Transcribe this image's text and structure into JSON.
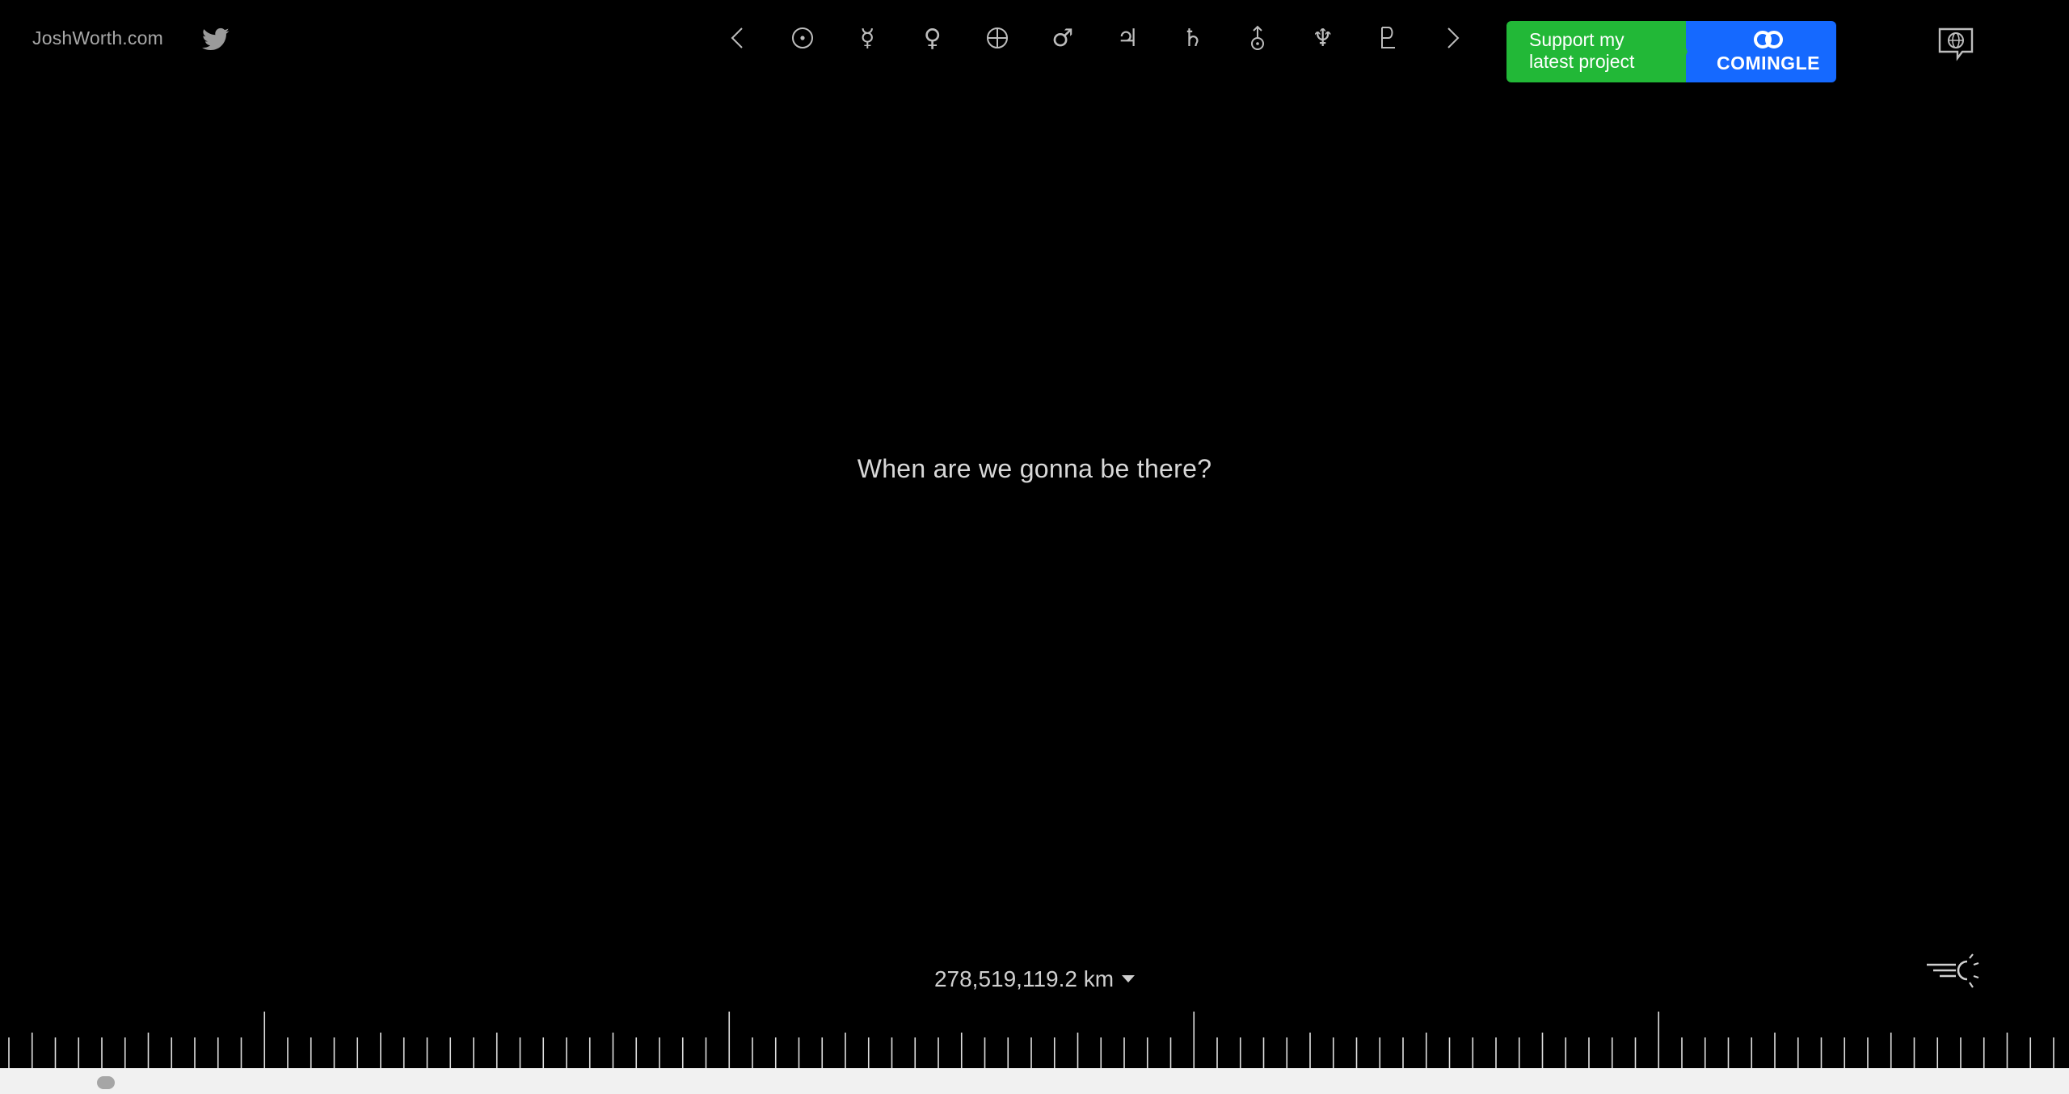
{
  "header": {
    "site_name": "JoshWorth.com",
    "twitter_icon": "twitter-bird-icon"
  },
  "planet_nav": {
    "prev": {
      "icon": "chevron-left-icon"
    },
    "items": [
      {
        "name": "sun",
        "glyph": "☉"
      },
      {
        "name": "mercury",
        "glyph": "☿"
      },
      {
        "name": "venus",
        "glyph": "♀"
      },
      {
        "name": "earth",
        "glyph": "⊕"
      },
      {
        "name": "mars",
        "glyph": "♂"
      },
      {
        "name": "jupiter",
        "glyph": "♃"
      },
      {
        "name": "saturn",
        "glyph": "♄"
      },
      {
        "name": "uranus",
        "glyph": "⛢"
      },
      {
        "name": "neptune",
        "glyph": "♆"
      },
      {
        "name": "pluto",
        "glyph": "♇"
      }
    ],
    "next": {
      "icon": "chevron-right-icon"
    }
  },
  "support": {
    "line1": "Support my",
    "line2": "latest project",
    "brand": "COMINGLE",
    "colors": {
      "left": "#22b837",
      "right": "#1569ff"
    }
  },
  "language_icon": "language-globe-icon",
  "main": {
    "message": "When are we gonna be there?"
  },
  "footer": {
    "distance": "278,519,119.2 km",
    "speed_icon": "speed-of-light-icon"
  },
  "colors": {
    "background": "#000000",
    "text": "#cfcfcf",
    "ruler": "#ffffff",
    "scrollbar": "#f1f1f1"
  }
}
